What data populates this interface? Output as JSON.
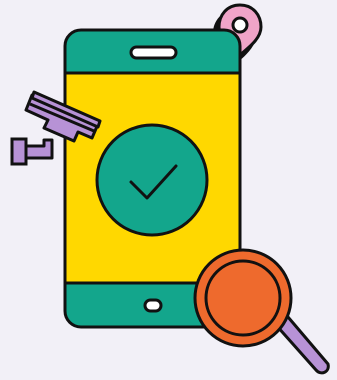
{
  "illustration": {
    "subject": "phone-security-verification",
    "icons": [
      "phone-icon",
      "checkmark-icon",
      "location-pin-icon",
      "security-camera-icon",
      "magnifying-glass-icon"
    ]
  },
  "colors": {
    "background": "#f2f0f7",
    "phone_body": "#13a68c",
    "phone_screen": "#ffd800",
    "check_circle": "#13a68c",
    "outline": "#111111",
    "pin_fill": "#f0a4c8",
    "camera_fill": "#b792d6",
    "magnifier_rim": "#ee6a2d",
    "magnifier_handle": "#b792d6",
    "white": "#ffffff"
  }
}
